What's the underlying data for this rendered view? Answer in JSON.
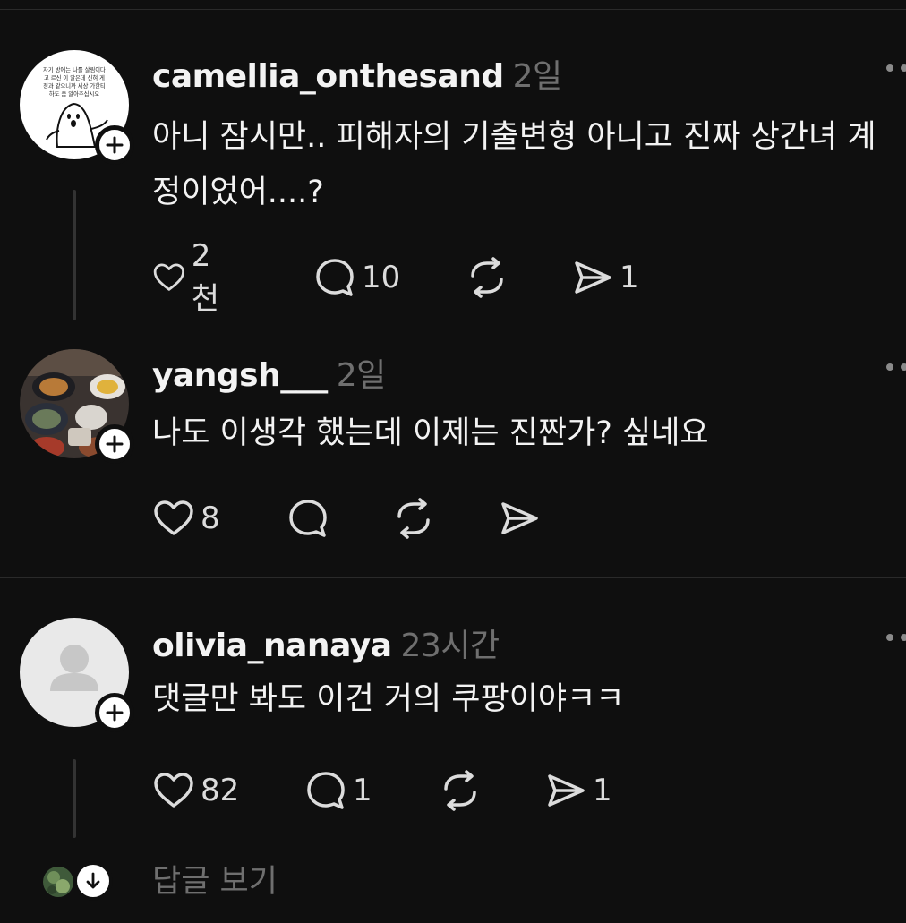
{
  "posts": [
    {
      "username": "camellia_onthesand",
      "time": "2일",
      "text": "아니 잠시만.. 피해자의 기출변형 아니고 진짜 상간녀 계정이었어....?",
      "likes": "2천",
      "comments": "10",
      "reposts": "",
      "shares": "1",
      "avatar_text": [
        "자기 방에는 나를 살림이다",
        "고 르신 이 알은데 신혀 게",
        "정과 같으니까 세상 가한티",
        "하도 좀 알아주십시오"
      ]
    },
    {
      "username": "yangsh___",
      "time": "2일",
      "text": "나도 이생각 했는데 이제는 진짠가? 싶네요",
      "likes": "8",
      "comments": "",
      "reposts": "",
      "shares": ""
    },
    {
      "username": "olivia_nanaya",
      "time": "23시간",
      "text": "댓글만 봐도 이건 거의 쿠팡이야ㅋㅋ",
      "likes": "82",
      "comments": "1",
      "reposts": "",
      "shares": "1"
    }
  ],
  "replies_link": "답글 보기",
  "icons": {
    "like": "heart-icon",
    "comment": "comment-bubble-icon",
    "repost": "repost-icon",
    "share": "send-icon",
    "follow": "plus-icon",
    "more": "more-dots-icon",
    "expand": "arrow-down-icon"
  }
}
